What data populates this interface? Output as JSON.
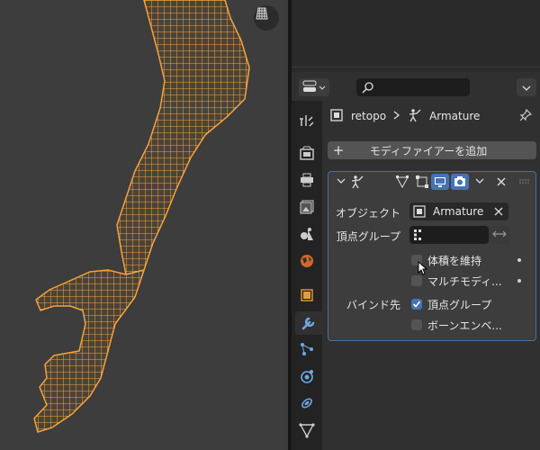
{
  "properties": {
    "breadcrumb": {
      "object": "retopo",
      "modifier": "Armature"
    },
    "add_modifier_label": "モディファイアーを追加",
    "modifier": {
      "object_label": "オブジェクト",
      "object_value": "Armature",
      "vertex_group_label": "頂点グループ",
      "preserve_volume_label": "体積を維持",
      "multi_modifier_label": "マルチモディ...",
      "bind_to_label": "バインド先",
      "bind_vertex_groups_label": "頂点グループ",
      "bind_bone_envelopes_label": "ボーンエンベ...",
      "preserve_volume_checked": false,
      "multi_modifier_checked": false,
      "bind_vertex_groups_checked": true,
      "bind_bone_envelopes_checked": false
    }
  },
  "colors": {
    "wireframe": "#f7a23a",
    "accent": "#4772b3",
    "viewport_bg": "#3d3d3d"
  },
  "icons": [
    "grid-icon",
    "editor-type-icon",
    "search-icon",
    "chevron-down-icon",
    "tool-icon",
    "render-icon",
    "output-icon",
    "view-layer-icon",
    "scene-icon",
    "world-icon",
    "object-icon",
    "modifier-icon",
    "particles-icon",
    "physics-icon",
    "constraints-icon",
    "data-icon",
    "mesh-icon",
    "armature-icon",
    "pin-icon",
    "close-icon"
  ]
}
